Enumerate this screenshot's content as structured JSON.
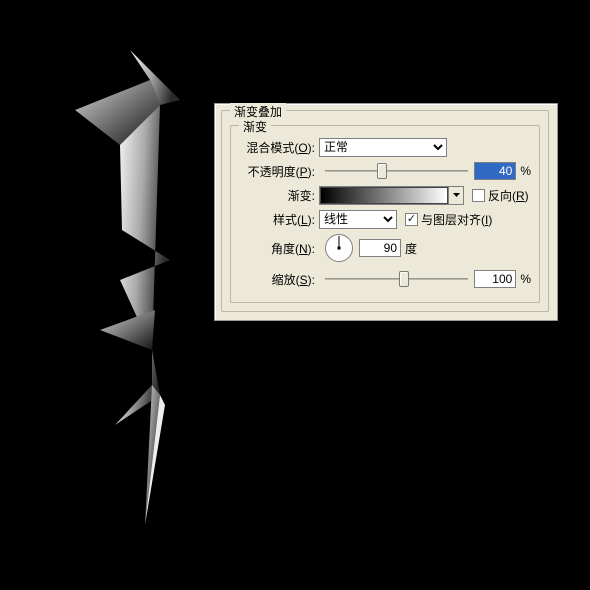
{
  "panel": {
    "title": "渐变叠加",
    "inner_title": "渐变",
    "blend_mode": {
      "label_pre": "混合模式(",
      "hotkey": "O",
      "label_post": "):",
      "value": "正常"
    },
    "opacity": {
      "label_pre": "不透明度(",
      "hotkey": "P",
      "label_post": "):",
      "value": "40",
      "unit": "%",
      "slider_pos_pct": 40
    },
    "gradient": {
      "label": "渐变:",
      "reverse_label_pre": "反向(",
      "reverse_hotkey": "R",
      "reverse_label_post": ")",
      "reverse_checked": false
    },
    "style": {
      "label_pre": "样式(",
      "hotkey": "L",
      "label_post": "):",
      "value": "线性",
      "align_checked": true,
      "align_label_pre": "与图层对齐(",
      "align_hotkey": "I",
      "align_label_post": ")"
    },
    "angle": {
      "label_pre": "角度(",
      "hotkey": "N",
      "label_post": "):",
      "value": "90",
      "unit": "度"
    },
    "scale": {
      "label_pre": "缩放(",
      "hotkey": "S",
      "label_post": "):",
      "value": "100",
      "unit": "%",
      "slider_pos_pct": 55
    }
  }
}
